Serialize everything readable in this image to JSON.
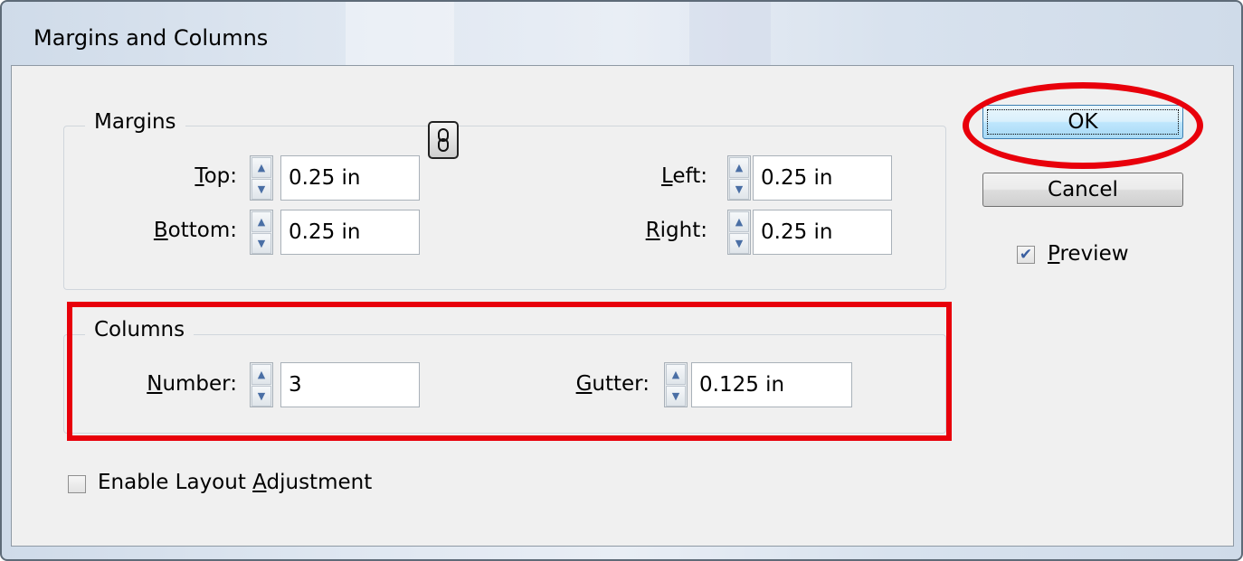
{
  "window": {
    "title": "Margins and Columns"
  },
  "margins": {
    "group_label": "Margins",
    "top": {
      "label_accel": "T",
      "label_rest": "op:",
      "value": "0.25 in"
    },
    "bottom": {
      "label_accel": "B",
      "label_rest": "ottom:",
      "value": "0.25 in"
    },
    "left": {
      "label_accel": "L",
      "label_rest": "eft:",
      "value": "0.25 in"
    },
    "right": {
      "label_accel": "R",
      "label_rest": "ight:",
      "value": "0.25 in"
    },
    "link_icon": "chain-link-icon"
  },
  "columns": {
    "group_label": "Columns",
    "number": {
      "label_accel": "N",
      "label_rest": "umber:",
      "value": "3"
    },
    "gutter": {
      "label_accel": "G",
      "label_rest": "utter:",
      "value": "0.125 in"
    }
  },
  "buttons": {
    "ok": "OK",
    "cancel": "Cancel"
  },
  "preview": {
    "checked": true,
    "label_accel": "P",
    "label_rest": "review"
  },
  "enable_layout": {
    "checked": false,
    "label_pre": "Enable Layout ",
    "label_accel": "A",
    "label_rest": "djustment"
  },
  "colors": {
    "annotation": "#e8000b"
  }
}
